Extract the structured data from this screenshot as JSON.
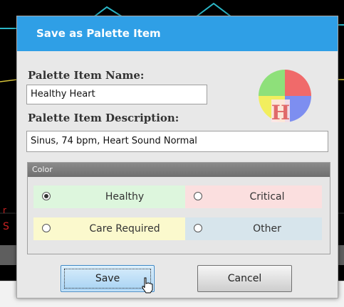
{
  "dialog": {
    "title": "Save as Palette Item",
    "name_label": "Palette Item Name:",
    "name_value": "Healthy Heart",
    "description_label": "Palette Item Description:",
    "description_value": "Sinus, 74 bpm, Heart Sound Normal",
    "logo_letter": "H",
    "color_group": {
      "title": "Color",
      "selected": "Healthy",
      "options": [
        {
          "label": "Healthy",
          "checked": true,
          "color": "#ddf6dd"
        },
        {
          "label": "Critical",
          "checked": false,
          "color": "#fbdfdf"
        },
        {
          "label": "Care Required",
          "checked": false,
          "color": "#fbf9cd"
        },
        {
          "label": "Other",
          "checked": false,
          "color": "#d7e5ec"
        }
      ]
    },
    "buttons": {
      "save": "Save",
      "cancel": "Cancel"
    }
  },
  "colors": {
    "title_bar": "#2f9fe6",
    "dialog_bg": "#e8e8e8",
    "group_header": "#7d7d7d"
  },
  "icons": [
    "palette-logo-icon",
    "mouse-cursor-icon"
  ]
}
